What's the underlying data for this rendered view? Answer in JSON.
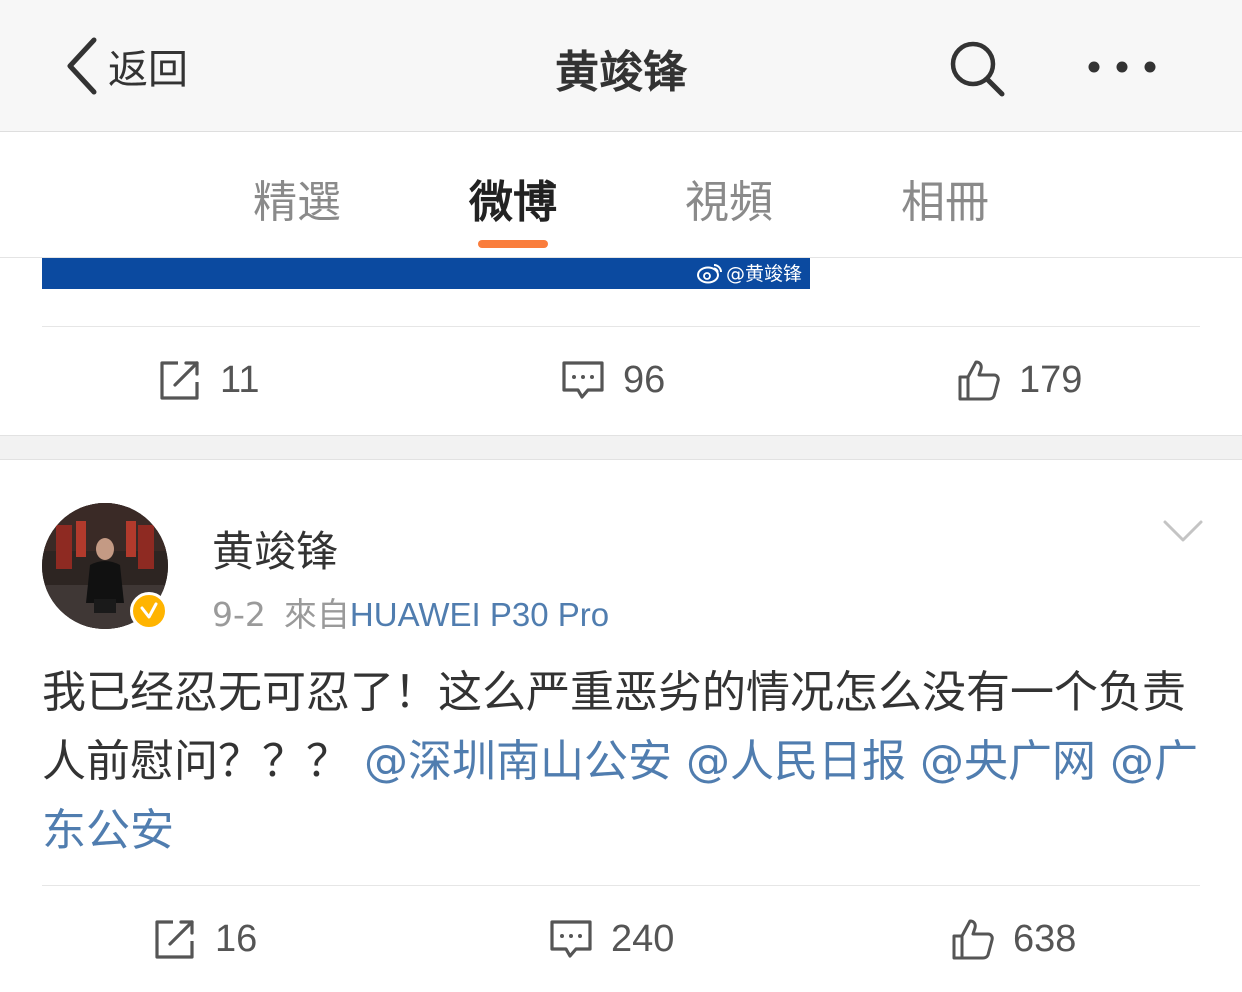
{
  "header": {
    "back_label": "返回",
    "title": "黄竣锋",
    "back_icon": "chevron-left-icon",
    "search_icon": "search-icon",
    "more_icon": "more-dots-icon"
  },
  "tabs": [
    {
      "label": "精選",
      "active": false
    },
    {
      "label": "微博",
      "active": true
    },
    {
      "label": "視頻",
      "active": false
    },
    {
      "label": "相冊",
      "active": false
    }
  ],
  "accent_color": "#fa7d3c",
  "link_color": "#507daf",
  "previous_post": {
    "image_watermark": "@黄竣锋",
    "actions": {
      "reposts": "11",
      "comments": "96",
      "likes": "179"
    }
  },
  "post": {
    "author": "黄竣锋",
    "date": "9-2",
    "source_prefix": "來自",
    "source": "HUAWEI P30 Pro",
    "verified": true,
    "text_parts": [
      {
        "text": "我已经忍无可忍了！这么严重恶劣的情况怎么没有一个负责人前慰问？？？ ",
        "mention": false
      },
      {
        "text": "@深圳南山公安",
        "mention": true
      },
      {
        "text": " ",
        "mention": false
      },
      {
        "text": "@人民日报",
        "mention": true
      },
      {
        "text": " ",
        "mention": false
      },
      {
        "text": "@央广网",
        "mention": true
      },
      {
        "text": " ",
        "mention": false
      },
      {
        "text": "@广东公安",
        "mention": true
      }
    ],
    "actions": {
      "reposts": "16",
      "comments": "240",
      "likes": "638"
    }
  }
}
